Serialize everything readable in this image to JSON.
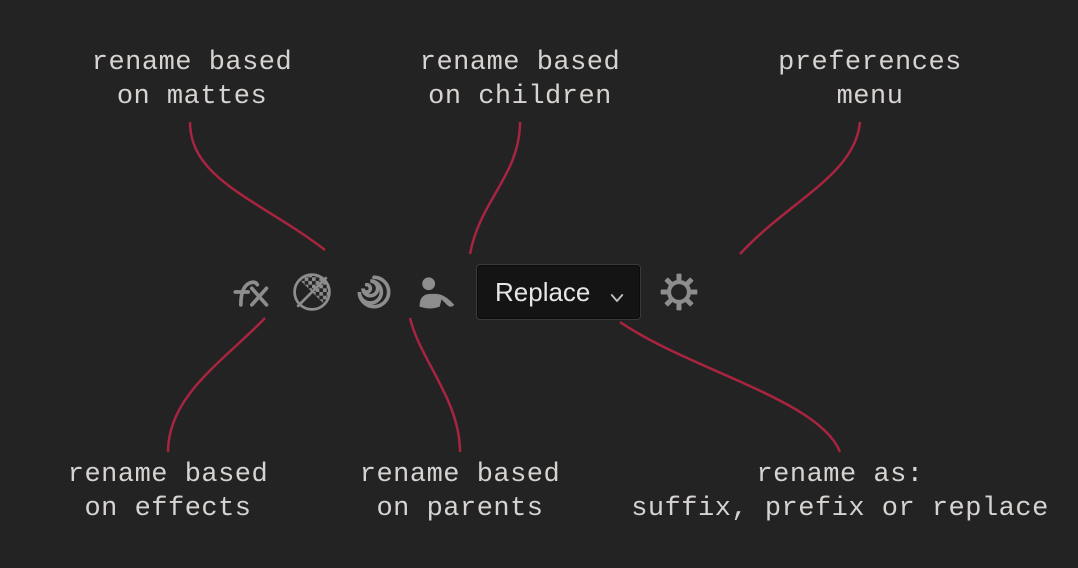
{
  "labels": {
    "mattes": "rename based\non mattes",
    "children": "rename based\non children",
    "prefs": "preferences\nmenu",
    "effects": "rename based\non effects",
    "parents": "rename based\non parents",
    "renameas": "rename as:\nsuffix, prefix or replace"
  },
  "toolbar": {
    "dropdown_value": "Replace"
  }
}
